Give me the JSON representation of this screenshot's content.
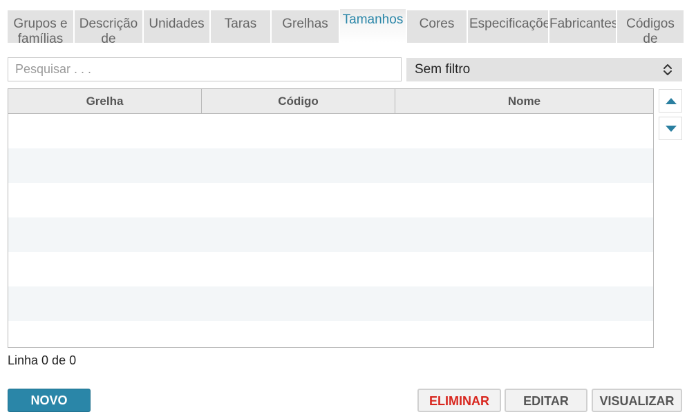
{
  "tabs": [
    {
      "label": "Grupos e famílias"
    },
    {
      "label": "Descrição de"
    },
    {
      "label": "Unidades"
    },
    {
      "label": "Taras"
    },
    {
      "label": "Grelhas"
    },
    {
      "label": "Tamanhos",
      "active": true
    },
    {
      "label": "Cores"
    },
    {
      "label": "Especificações"
    },
    {
      "label": "Fabricantes"
    },
    {
      "label": "Códigos de"
    }
  ],
  "search": {
    "placeholder": "Pesquisar . . ."
  },
  "filter": {
    "selected": "Sem filtro"
  },
  "table": {
    "columns": [
      "Grelha",
      "Código",
      "Nome"
    ],
    "rows": []
  },
  "status": {
    "text": "Linha 0 de 0"
  },
  "buttons": {
    "new": "NOVO",
    "delete": "ELIMINAR",
    "edit": "EDITAR",
    "view": "VISUALIZAR"
  },
  "colors": {
    "accent": "#2a86a8",
    "danger": "#d8261e",
    "tab_bg": "#e2e2e2"
  },
  "icons": {
    "sort_up": "triangle-up-icon",
    "sort_down": "triangle-down-icon",
    "select": "chevron-up-down-icon"
  }
}
